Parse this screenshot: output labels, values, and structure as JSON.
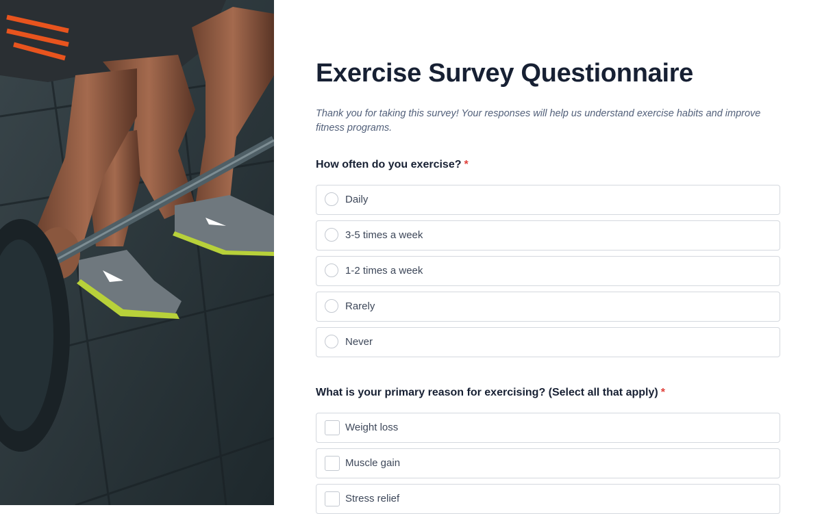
{
  "form": {
    "title": "Exercise Survey Questionnaire",
    "intro": "Thank you for taking this survey! Your responses will help us understand exercise habits and improve fitness programs.",
    "questions": [
      {
        "label": "How often do you exercise?",
        "required_mark": "*",
        "type": "radio",
        "options": [
          "Daily",
          "3-5 times a week",
          "1-2 times a week",
          "Rarely",
          "Never"
        ]
      },
      {
        "label": "What is your primary reason for exercising? (Select all that apply)",
        "required_mark": "*",
        "type": "checkbox",
        "options": [
          "Weight loss",
          "Muscle gain",
          "Stress relief"
        ]
      }
    ]
  },
  "colors": {
    "title": "#172033",
    "required": "#e0403a",
    "border": "#d4d8de",
    "intro": "#52607a"
  },
  "hero_image": {
    "icon": "weightlifter-photo"
  }
}
